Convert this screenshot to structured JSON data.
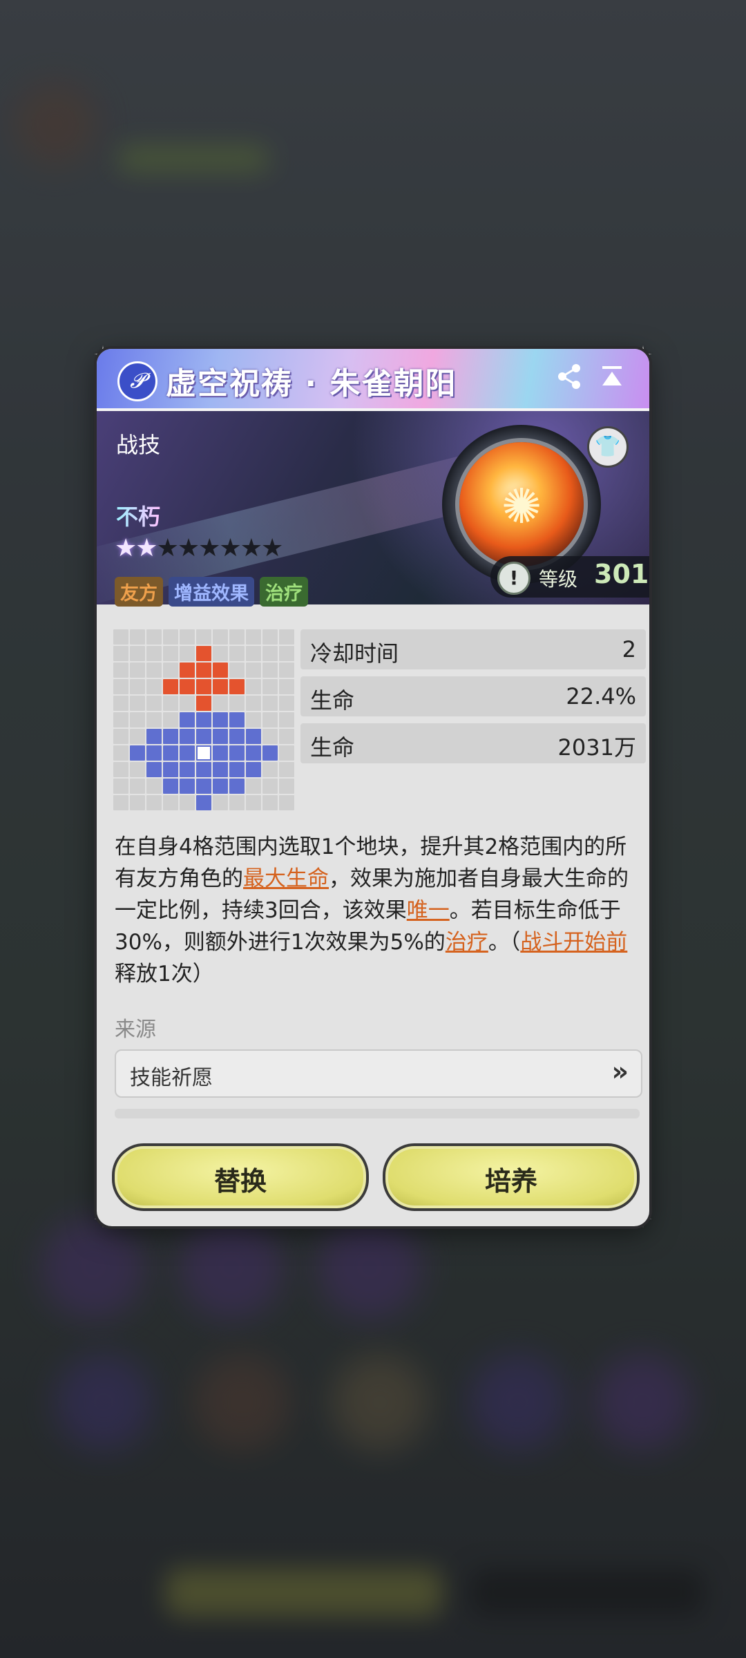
{
  "title": "虚空祝祷 · 朱雀朝阳",
  "header_icons": {
    "skill_icon": "quill-icon",
    "share": "share-icon",
    "collapse": "collapse-icon"
  },
  "skill": {
    "type": "战技",
    "name": "不朽",
    "stars_filled": 2,
    "stars_total": 8,
    "tags": [
      "友方",
      "增益效果",
      "治疗"
    ],
    "level_label": "等级",
    "level_value": "301"
  },
  "stats": [
    {
      "label": "冷却时间",
      "value": "2"
    },
    {
      "label": "生命",
      "value": "22.4%"
    },
    {
      "label": "生命",
      "value": "2031万"
    }
  ],
  "description": {
    "p1": "在自身4格范围内选取1个地块，提升其2格范围内的所有友方角色的",
    "kw1": "最大生命",
    "p2": "，效果为施加者自身最大生命的一定比例，持续3回合，该效果",
    "kw2": "唯一",
    "p3": "。若目标生命低于30%，则额外进行1次效果为5%的",
    "kw3": "治疗",
    "p4": "。（",
    "kw4": "战斗开始前",
    "p5": "释放1次）"
  },
  "source": {
    "label": "来源",
    "value": "技能祈愿"
  },
  "buttons": {
    "replace": "替换",
    "cultivate": "培养"
  },
  "colors": {
    "keyword": "#d5621e",
    "grid_red": "#e4532e",
    "grid_blue": "#5f6fd0",
    "button": "#dfdd6e"
  }
}
